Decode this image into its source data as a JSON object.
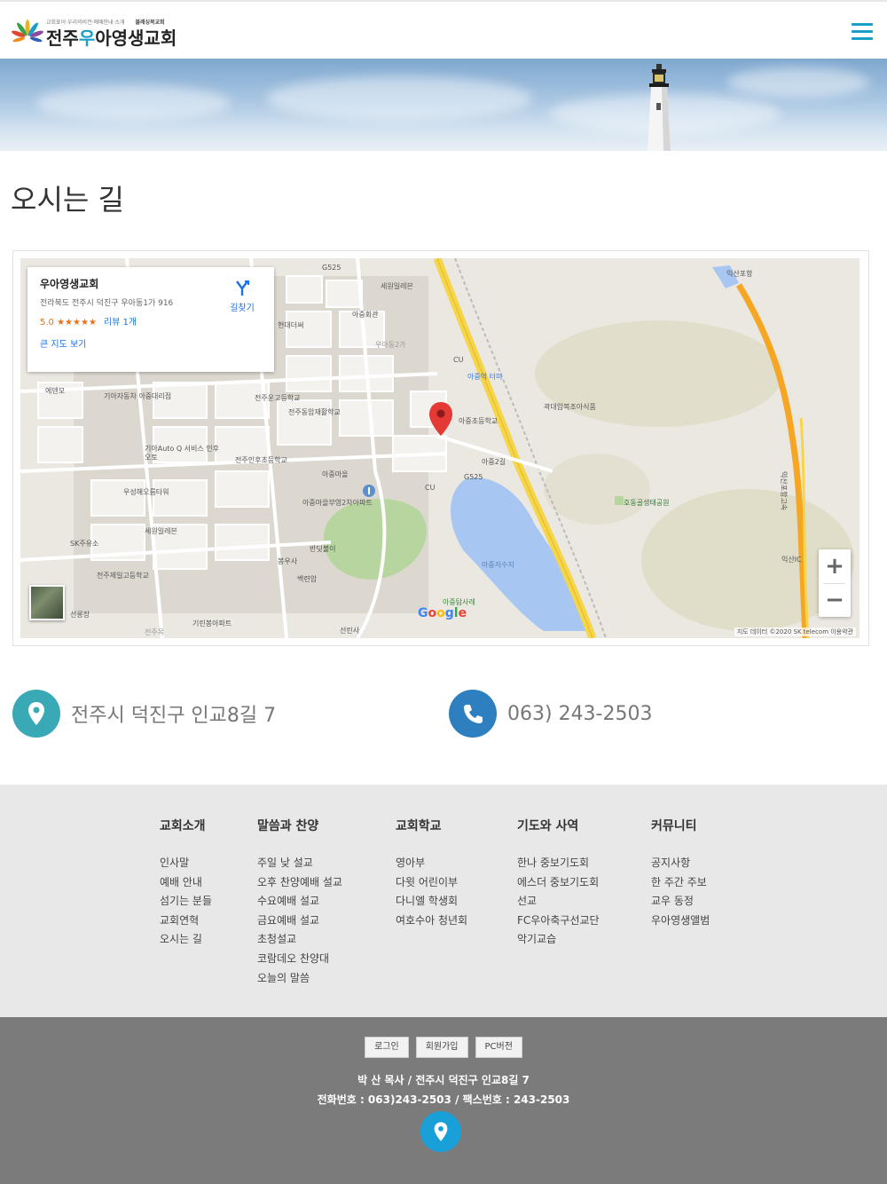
{
  "header": {
    "logo_tagline": "교회표어·우리의비전·예배안내·소개",
    "logo_tagline2": "블레싱목교회",
    "logo_name_1": "전주",
    "logo_name_2": "우",
    "logo_name_3": "아영생교회",
    "menu_icon": "hamburger-icon"
  },
  "page": {
    "title": "오시는 길"
  },
  "map": {
    "place_name": "우아영생교회",
    "place_address": "전라북도 전주시 덕진구 우아동1가 916",
    "rating": "5.0 ★★★★★",
    "reviews": "리뷰 1개",
    "bigger_map": "큰 지도 보기",
    "directions": "길찾기",
    "attribution": "지도 데이터 ©2020 SK telecom   이용약관",
    "google": "Google",
    "zoom_in": "+",
    "zoom_out": "−",
    "labels": {
      "l1": "G525",
      "l2": "세원일레븐",
      "l3": "아중회관",
      "l4": "현대더써",
      "l5": "우아동2가",
      "l6": "CU",
      "l7": "아중역 터미",
      "l8": "에덴모",
      "l9": "기아자동차 아중대리점",
      "l10": "전주운고등학교",
      "l11": "전주동암재활학교",
      "l12": "아중초등학교",
      "l13": "곽대암복조아식품",
      "l14": "기아Auto Q 서비스 인후오토",
      "l15": "전주인후초등학교",
      "l16": "아중마을",
      "l17": "아중2길",
      "l18": "G525",
      "l19": "CU",
      "l20": "우성해오름타워",
      "l21": "아중마을부영2차아파트",
      "l22": "세원일레븐",
      "l23": "SK주유소",
      "l24": "반딧불이",
      "l25": "전주제일고등학교",
      "l26": "봉우사",
      "l27": "백련암",
      "l28": "아중저수지",
      "l29": "아중탐사레",
      "l30": "기린봉아파트",
      "l31": "선린사",
      "l32": "호동골생태공원",
      "l33": "익산포항",
      "l34": "익산IC",
      "l35": "익산포항고속",
      "l36": "선릉장",
      "l37": "전주목"
    }
  },
  "contact": {
    "address": "전주시 덕진구 인교8길 7",
    "phone": "063) 243-2503"
  },
  "footer_nav": {
    "col1": {
      "title": "교회소개",
      "items": [
        "인사말",
        "예배 안내",
        "섬기는 분들",
        "교회연혁",
        "오시는 길"
      ]
    },
    "col2": {
      "title": "말씀과 찬양",
      "items": [
        "주일 낮 설교",
        "오후 찬양예배 설교",
        "수요예배 설교",
        "금요예배 설교",
        "초청설교",
        "코람데오 찬양대",
        "오늘의 말씀"
      ]
    },
    "col3": {
      "title": "교회학교",
      "items": [
        "영아부",
        "다윗 어린이부",
        "다니엘 학생회",
        "여호수아 청년회"
      ]
    },
    "col4": {
      "title": "기도와 사역",
      "items": [
        "한나 중보기도회",
        "에스더 중보기도회",
        "선교",
        "FC우아축구선교단",
        "악기교습"
      ]
    },
    "col5": {
      "title": "커뮤니티",
      "items": [
        "공지사항",
        "한 주간 주보",
        "교우 동정",
        "우아영생앨범"
      ]
    }
  },
  "footer_bottom": {
    "login": "로그인",
    "signup": "회원가입",
    "pc": "PC버전",
    "line1": "박 산 목사 / 전주시 덕진구 인교8길 7",
    "line2": "전화번호 : 063)243-2503 / 팩스번호 : 243-2503"
  },
  "colors": {
    "accent": "#1aa0c8",
    "address_circle": "#3aa9b6",
    "phone_circle": "#2e7fc0",
    "footer_gray": "#7b7b7b"
  }
}
